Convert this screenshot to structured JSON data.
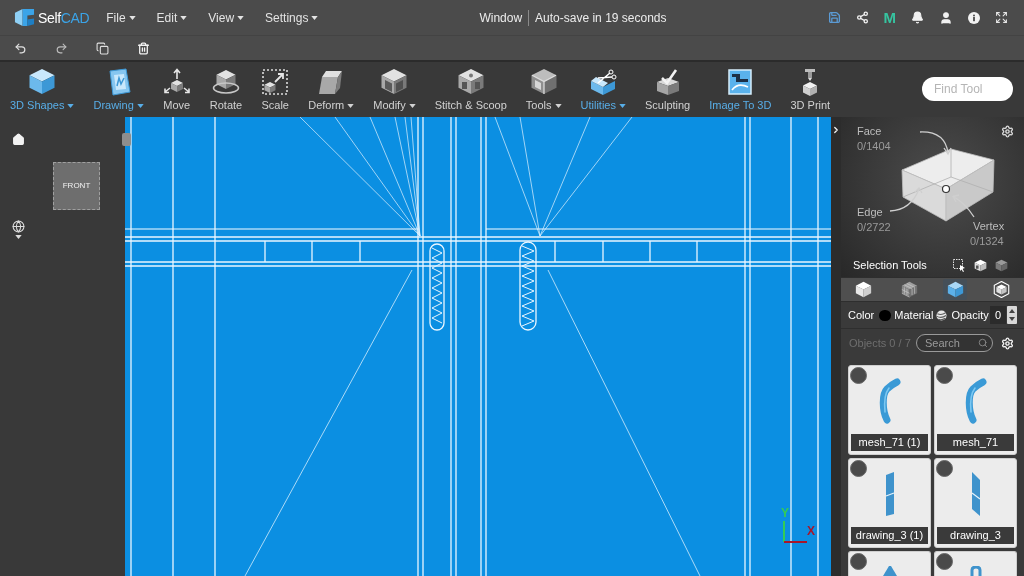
{
  "header": {
    "logo": [
      "Self",
      "CAD"
    ],
    "menus": [
      "File",
      "Edit",
      "View",
      "Settings"
    ],
    "title": "Window",
    "autosave": "Auto-save in 19 seconds",
    "badge": "M"
  },
  "toolbar": {
    "tools": [
      {
        "label": "3D Shapes",
        "has_menu": true,
        "highlighted": true
      },
      {
        "label": "Drawing",
        "has_menu": true,
        "highlighted": true
      },
      {
        "label": "Move",
        "has_menu": false,
        "highlighted": false
      },
      {
        "label": "Rotate",
        "has_menu": false,
        "highlighted": false
      },
      {
        "label": "Scale",
        "has_menu": false,
        "highlighted": false
      },
      {
        "label": "Deform",
        "has_menu": true,
        "highlighted": false
      },
      {
        "label": "Modify",
        "has_menu": true,
        "highlighted": false
      },
      {
        "label": "Stitch & Scoop",
        "has_menu": false,
        "highlighted": false
      },
      {
        "label": "Tools",
        "has_menu": true,
        "highlighted": false
      },
      {
        "label": "Utilities",
        "has_menu": true,
        "highlighted": true
      },
      {
        "label": "Sculpting",
        "has_menu": false,
        "highlighted": false
      },
      {
        "label": "Image To 3D",
        "has_menu": false,
        "highlighted": true
      },
      {
        "label": "3D Print",
        "has_menu": false,
        "highlighted": false
      }
    ],
    "find_tool": {
      "placeholder": "Find Tool"
    }
  },
  "view_cube": {
    "label": "FRONT"
  },
  "viewport": {
    "axes": [
      {
        "label": "Y",
        "color": "#33cc55"
      },
      {
        "label": "X",
        "color": "#a8162a"
      }
    ]
  },
  "selection_info": [
    {
      "label": "Face",
      "count": "0/1404"
    },
    {
      "label": "Edge",
      "count": "0/2722"
    },
    {
      "label": "Vertex",
      "count": "0/1324"
    }
  ],
  "selection_tools": {
    "label": "Selection Tools"
  },
  "selection_modes": [
    {
      "kind": "object",
      "selected": false
    },
    {
      "kind": "grid",
      "selected": false
    },
    {
      "kind": "face",
      "selected": true
    },
    {
      "kind": "outline",
      "selected": false
    }
  ],
  "appearance": {
    "color_label": "Color",
    "color": "#000000",
    "material_label": "Material",
    "opacity_label": "Opacity",
    "opacity": "0"
  },
  "objects": {
    "count": "Objects 0 / 7",
    "search": {
      "placeholder": "Search"
    },
    "items": [
      {
        "name": "mesh_71 (1)",
        "kind": "hook",
        "selected": false
      },
      {
        "name": "mesh_71",
        "kind": "hook",
        "selected": false
      },
      {
        "name": "drawing_3 (1)",
        "kind": "slab",
        "selected": false
      },
      {
        "name": "drawing_3",
        "kind": "blade",
        "selected": false
      },
      {
        "kind": "wedge",
        "selected": false
      },
      {
        "kind": "loop",
        "selected": false
      }
    ]
  }
}
